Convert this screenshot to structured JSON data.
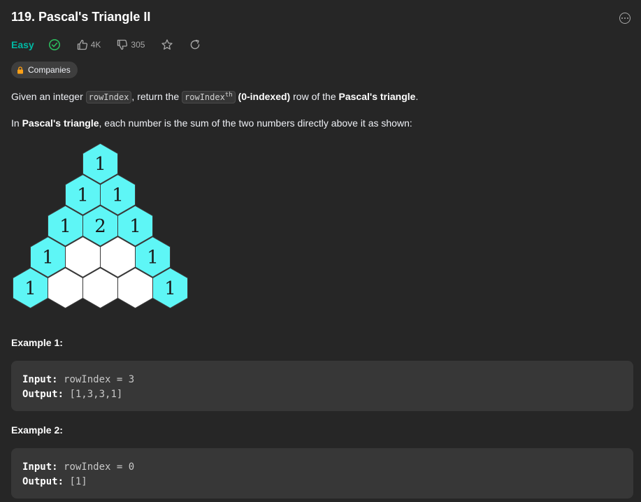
{
  "problem": {
    "title": "119. Pascal's Triangle II",
    "difficulty": "Easy",
    "likes": "4K",
    "dislikes": "305",
    "companies_label": "Companies"
  },
  "description": {
    "p1_a": "Given an integer ",
    "p1_code1": "rowIndex",
    "p1_b": ", return the ",
    "p1_code2": "rowIndex",
    "p1_code2_sup": "th",
    "p1_c": " ",
    "p1_bold1": "(0-indexed)",
    "p1_d": " row of the ",
    "p1_bold2": "Pascal's triangle",
    "p1_e": ".",
    "p2_a": "In ",
    "p2_bold": "Pascal's triangle",
    "p2_b": ", each number is the sum of the two numbers directly above it as shown:"
  },
  "triangle_rows": [
    [
      "1"
    ],
    [
      "1",
      "1"
    ],
    [
      "1",
      "2",
      "1"
    ],
    [
      "1",
      "",
      "",
      "1"
    ],
    [
      "1",
      "",
      "",
      "",
      "1"
    ]
  ],
  "colors": {
    "cell_filled": "#5ef6f6",
    "cell_empty": "#ffffff",
    "easy": "#00b8a3",
    "solved_check": "#2cbb5d"
  },
  "examples": [
    {
      "title": "Example 1:",
      "input_label": "Input:",
      "input_value": "rowIndex = 3",
      "output_label": "Output:",
      "output_value": "[1,3,3,1]"
    },
    {
      "title": "Example 2:",
      "input_label": "Input:",
      "input_value": "rowIndex = 0",
      "output_label": "Output:",
      "output_value": "[1]"
    }
  ]
}
